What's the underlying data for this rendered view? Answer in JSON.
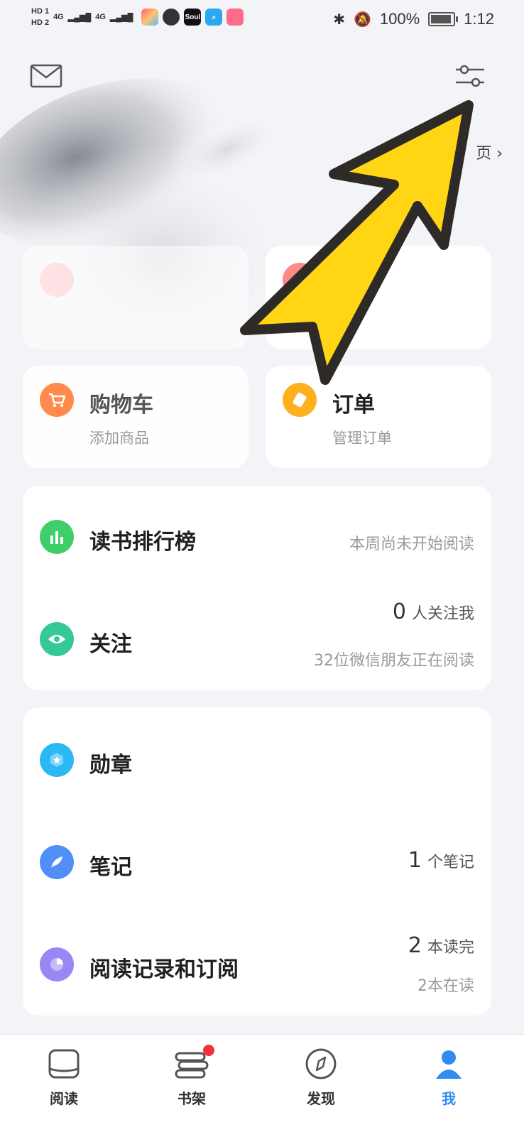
{
  "status": {
    "hd1": "HD 1",
    "hd2": "HD 2",
    "net1": "4G",
    "net2": "4G",
    "battery": "100%",
    "time": "1:12",
    "soul_label": "Soul"
  },
  "header": {
    "right_link": "页 ›"
  },
  "cards": {
    "cart": {
      "title": "购物车",
      "sub": "添加商品"
    },
    "order": {
      "title": "订单",
      "sub": "管理订单"
    }
  },
  "ranking": {
    "title": "读书排行榜",
    "right": "本周尚未开始阅读"
  },
  "follow": {
    "title": "关注",
    "count": "0",
    "count_label": "人关注我",
    "sub": "32位微信朋友正在阅读"
  },
  "badge": {
    "title": "勋章"
  },
  "notes": {
    "title": "笔记",
    "count": "1",
    "count_label": "个笔记"
  },
  "history": {
    "title": "阅读记录和订阅",
    "count": "2",
    "count_label": "本读完",
    "sub": "2本在读"
  },
  "tabs": [
    {
      "label": "阅读"
    },
    {
      "label": "书架"
    },
    {
      "label": "发现"
    },
    {
      "label": "我"
    }
  ],
  "colors": {
    "cart": "#ff8a4c",
    "order": "#ffb01f",
    "ranking": "#3fcf6a",
    "follow": "#35c99a",
    "badge": "#2bb8f3",
    "notes": "#4f8ff7",
    "history": "#9a86f5",
    "arrow": "#ffd514"
  }
}
